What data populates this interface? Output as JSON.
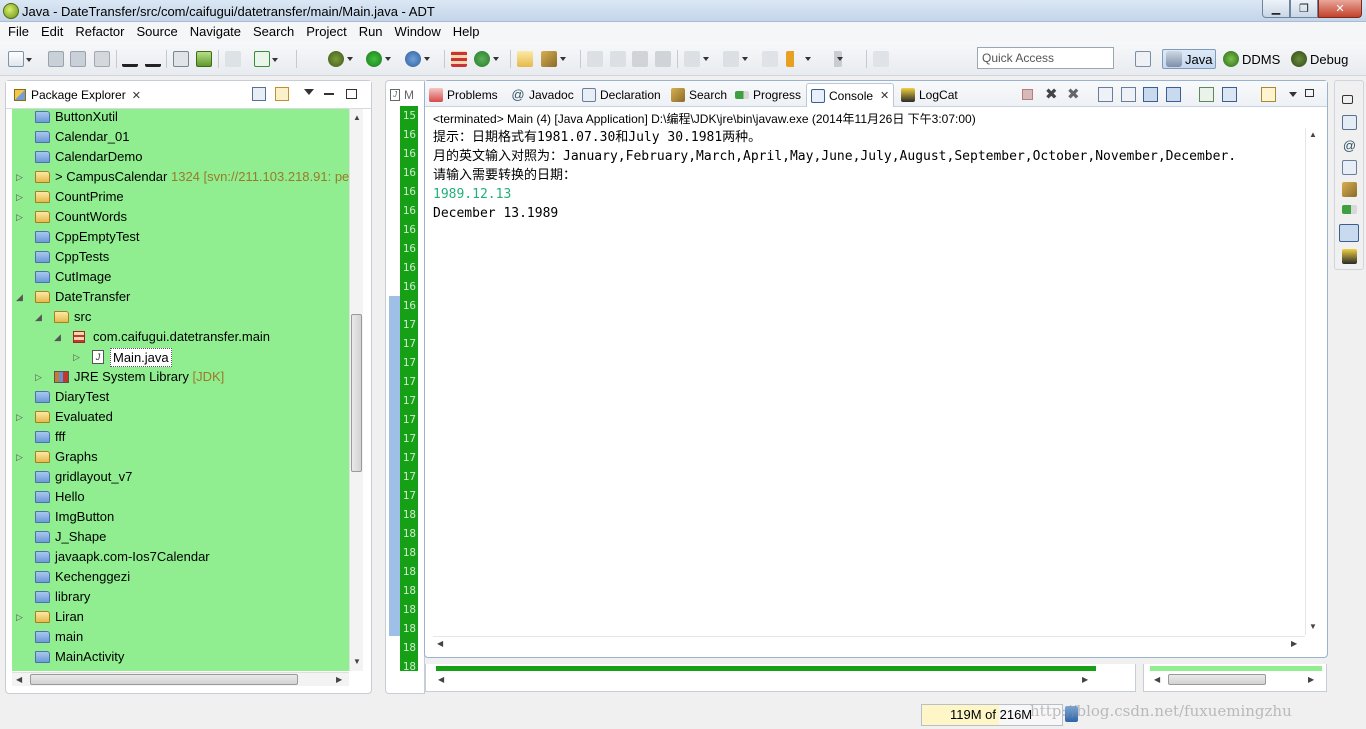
{
  "window": {
    "title": "Java - DateTransfer/src/com/caifugui/datetransfer/main/Main.java - ADT",
    "min_glyph": "▁",
    "max_glyph": "❐",
    "close_glyph": "✕"
  },
  "menu": [
    "File",
    "Edit",
    "Refactor",
    "Source",
    "Navigate",
    "Search",
    "Project",
    "Run",
    "Window",
    "Help"
  ],
  "toolbar": {
    "quick_access_placeholder": "Quick Access",
    "perspectives": [
      "Java",
      "DDMS",
      "Debug"
    ]
  },
  "package_explorer": {
    "tab_label": "Package Explorer",
    "close": "✕",
    "items": [
      {
        "label": "ButtonXutil",
        "level": 0,
        "expander": "",
        "icon": "folder"
      },
      {
        "label": "Calendar_01",
        "level": 0,
        "expander": "",
        "icon": "folder"
      },
      {
        "label": "CalendarDemo",
        "level": 0,
        "expander": "",
        "icon": "folder"
      },
      {
        "label": "> CampusCalendar",
        "suffix": " 1324 [svn://211.103.218.91: pe",
        "level": 0,
        "expander": "▷",
        "icon": "folder-open"
      },
      {
        "label": "CountPrime",
        "level": 0,
        "expander": "▷",
        "icon": "folder-open"
      },
      {
        "label": "CountWords",
        "level": 0,
        "expander": "▷",
        "icon": "folder-open"
      },
      {
        "label": "CppEmptyTest",
        "level": 0,
        "expander": "",
        "icon": "folder"
      },
      {
        "label": "CppTests",
        "level": 0,
        "expander": "",
        "icon": "folder"
      },
      {
        "label": "CutImage",
        "level": 0,
        "expander": "",
        "icon": "folder"
      },
      {
        "label": "DateTransfer",
        "level": 0,
        "expander": "◢",
        "icon": "folder-open"
      },
      {
        "label": "src",
        "level": 1,
        "expander": "◢",
        "icon": "folder-open"
      },
      {
        "label": "com.caifugui.datetransfer.main",
        "level": 2,
        "expander": "◢",
        "icon": "package"
      },
      {
        "label": "Main.java",
        "level": 3,
        "expander": "▷",
        "icon": "java",
        "selected": true
      },
      {
        "label": "JRE System Library",
        "suffix": " [JDK]",
        "level": 1,
        "expander": "▷",
        "icon": "library"
      },
      {
        "label": "DiaryTest",
        "level": 0,
        "expander": "",
        "icon": "folder"
      },
      {
        "label": "Evaluated",
        "level": 0,
        "expander": "▷",
        "icon": "folder-open"
      },
      {
        "label": "fff",
        "level": 0,
        "expander": "",
        "icon": "folder"
      },
      {
        "label": "Graphs",
        "level": 0,
        "expander": "▷",
        "icon": "folder-open"
      },
      {
        "label": "gridlayout_v7",
        "level": 0,
        "expander": "",
        "icon": "folder"
      },
      {
        "label": "Hello",
        "level": 0,
        "expander": "",
        "icon": "folder"
      },
      {
        "label": "ImgButton",
        "level": 0,
        "expander": "",
        "icon": "folder"
      },
      {
        "label": "J_Shape",
        "level": 0,
        "expander": "",
        "icon": "folder"
      },
      {
        "label": "javaapk.com-Ios7Calendar",
        "level": 0,
        "expander": "",
        "icon": "folder"
      },
      {
        "label": "Kechenggezi",
        "level": 0,
        "expander": "",
        "icon": "folder"
      },
      {
        "label": "library",
        "level": 0,
        "expander": "",
        "icon": "folder"
      },
      {
        "label": "Liran",
        "level": 0,
        "expander": "▷",
        "icon": "folder-open"
      },
      {
        "label": "main",
        "level": 0,
        "expander": "",
        "icon": "folder"
      },
      {
        "label": "MainActivity",
        "level": 0,
        "expander": "",
        "icon": "folder"
      }
    ]
  },
  "editor": {
    "tab_label": "M",
    "line_numbers": [
      "15",
      "16",
      "16",
      "16",
      "16",
      "16",
      "16",
      "16",
      "16",
      "16",
      "16",
      "17",
      "17",
      "17",
      "17",
      "17",
      "17",
      "17",
      "17",
      "17",
      "17",
      "18",
      "18",
      "18",
      "18",
      "18",
      "18",
      "18",
      "18",
      "18"
    ]
  },
  "console_panel": {
    "tabs": [
      "Problems",
      "Javadoc",
      "Declaration",
      "Search",
      "Progress",
      "Console",
      "LogCat"
    ],
    "active_tab": "Console",
    "close": "✕",
    "info": "<terminated> Main (4) [Java Application] D:\\编程\\JDK\\jre\\bin\\javaw.exe (2014年11月26日 下午3:07:00)",
    "lines": [
      {
        "text": "提示：日期格式有1981.07.30和July 30.1981两种。",
        "kind": "output"
      },
      {
        "text": "月的英文输入对照为：January,February,March,April,May,June,July,August,September,October,November,December.",
        "kind": "output"
      },
      {
        "text": "请输入需要转换的日期：",
        "kind": "output"
      },
      {
        "text": "1989.12.13",
        "kind": "input"
      },
      {
        "text": "December 13.1989",
        "kind": "output"
      }
    ]
  },
  "statusbar": {
    "heap": "119M of 216M",
    "watermark": "http://blog.csdn.net/fuxuemingzhu"
  },
  "colors": {
    "tree_bg": "#90ee90",
    "gutter_bg": "#15a015",
    "console_input": "#22b07a"
  }
}
